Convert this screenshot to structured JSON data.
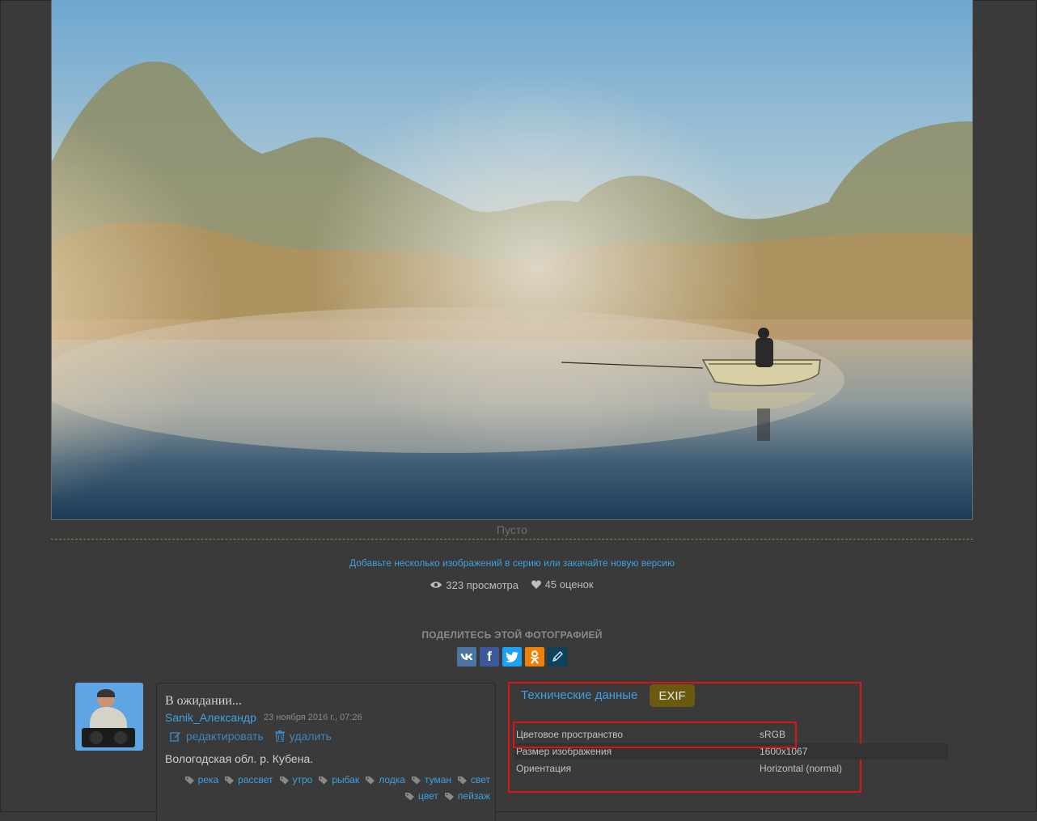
{
  "photo": {
    "caption": "Пусто"
  },
  "series_link": "Добавьте несколько изображений в серию или закачайте новую версию",
  "stats": {
    "views": "323 просмотра",
    "ratings": "45 оценок"
  },
  "share": {
    "title": "ПОДЕЛИТЕСЬ ЭТОЙ ФОТОГРАФИЕЙ",
    "buttons": [
      {
        "name": "vk",
        "label": "vk",
        "color": "#4c75a3"
      },
      {
        "name": "facebook",
        "label": "f",
        "color": "#3b5998"
      },
      {
        "name": "twitter",
        "label": "t",
        "color": "#1da1f2"
      },
      {
        "name": "odnoklassniki",
        "label": "ok",
        "color": "#ee8208"
      },
      {
        "name": "livejournal",
        "label": "lj",
        "color": "#0d425a"
      }
    ]
  },
  "post": {
    "title": "В ожидании...",
    "author": "Sanik_Александр",
    "date": "23 ноября 2016 г., 07:26",
    "edit_label": "редактировать",
    "delete_label": "удалить",
    "description": "Вологодская обл. р. Кубена.",
    "tags": [
      "река",
      "рассвет",
      "утро",
      "рыбак",
      "лодка",
      "туман",
      "свет",
      "цвет",
      "пейзаж"
    ]
  },
  "tech": {
    "tab_technical": "Технические данные",
    "tab_exif": "EXIF",
    "rows": [
      {
        "key": "Цветовое пространство",
        "value": "sRGB"
      },
      {
        "key": "Размер изображения",
        "value": "1600x1067"
      },
      {
        "key": "Ориентация",
        "value": "Horizontal (normal)"
      }
    ]
  },
  "colors": {
    "link": "#3fa0e0",
    "highlight": "#d91515",
    "exif_tab": "#6a5a10",
    "background": "#3a3a3a"
  }
}
